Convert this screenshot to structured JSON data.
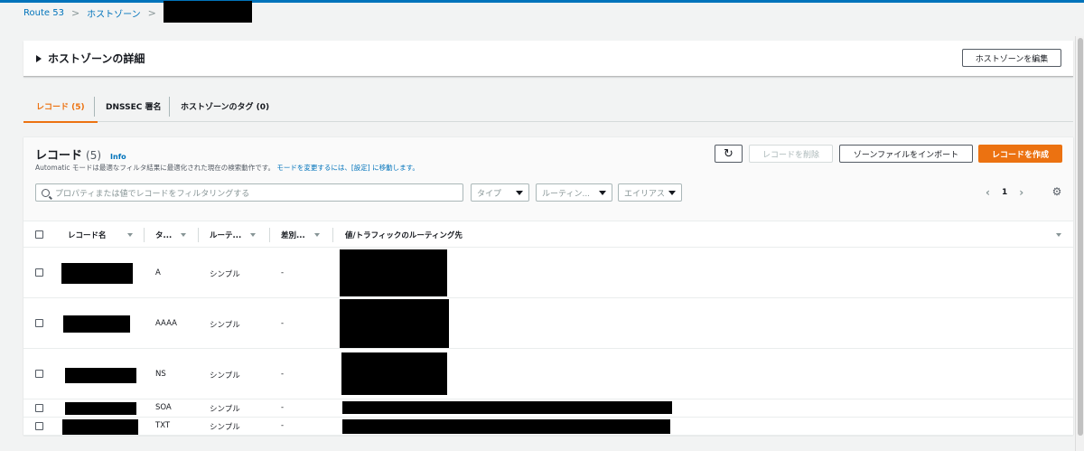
{
  "breadcrumb": {
    "root": "Route 53",
    "hosted_zones": "ホストゾーン"
  },
  "details": {
    "title": "ホストゾーンの詳細",
    "edit_button": "ホストゾーンを編集"
  },
  "tabs": [
    {
      "label": "レコード (5)",
      "active": true
    },
    {
      "label": "DNSSEC 署名",
      "active": false
    },
    {
      "label": "ホストゾーンのタグ (0)",
      "active": false
    }
  ],
  "records": {
    "title": "レコード",
    "count": "(5)",
    "info": "Info",
    "desc_text": "Automatic モードは最適なフィルタ結果に最適化された現在の検索動作です。",
    "desc_link": "モードを変更するには、[設定] に移動します。",
    "buttons": {
      "delete": "レコードを削除",
      "import": "ゾーンファイルをインポート",
      "create": "レコードを作成"
    },
    "filter_placeholder": "プロパティまたは値でレコードをフィルタリングする",
    "filters": {
      "type": "タイプ",
      "routing": "ルーティン...",
      "alias": "エイリアス"
    },
    "page": "1"
  },
  "table": {
    "columns": [
      "レコード名",
      "タ...",
      "ルーテ...",
      "差別...",
      "値/トラフィックのルーティング先"
    ],
    "rows": [
      {
        "type": "A",
        "routing": "シンプル",
        "diff": "-"
      },
      {
        "type": "AAAA",
        "routing": "シンプル",
        "diff": "-"
      },
      {
        "type": "NS",
        "routing": "シンプル",
        "diff": "-"
      },
      {
        "type": "SOA",
        "routing": "シンプル",
        "diff": "-"
      },
      {
        "type": "TXT",
        "routing": "シンプル",
        "diff": "-"
      }
    ]
  },
  "colors": {
    "accent": "#ec7211",
    "link": "#0073bb"
  }
}
